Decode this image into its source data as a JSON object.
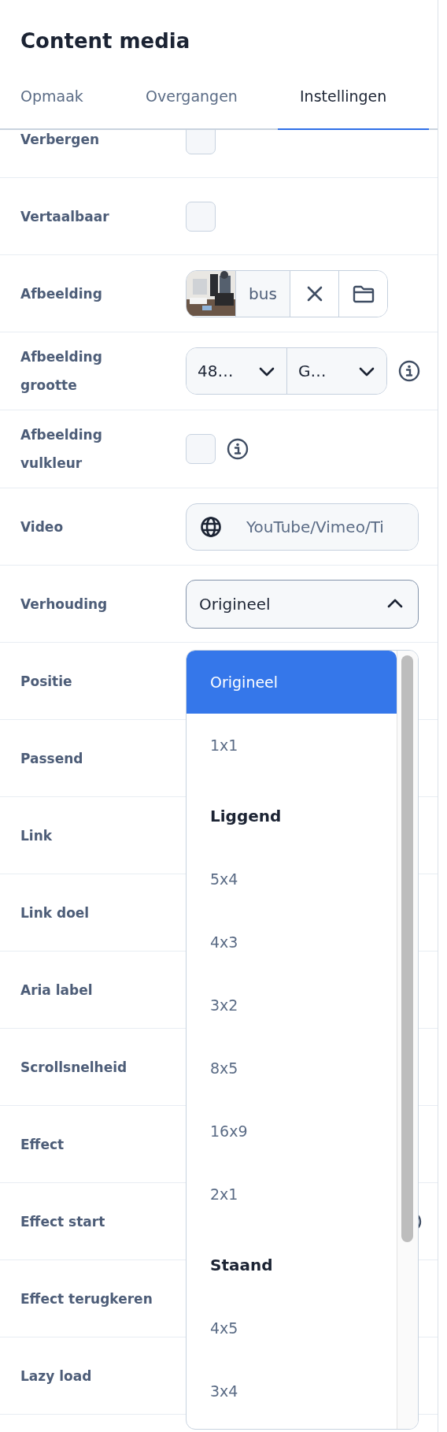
{
  "panel": {
    "title": "Content media"
  },
  "tabs": [
    {
      "label": "Opmaak",
      "selected": false
    },
    {
      "label": "Overgangen",
      "selected": false
    },
    {
      "label": "Instellingen",
      "selected": true
    }
  ],
  "rows": [
    {
      "label": "Verbergen",
      "kind": "checkbox",
      "checked": false
    },
    {
      "label": "Vertaalbaar",
      "kind": "checkbox",
      "checked": false
    },
    {
      "label": "Afbeelding",
      "value": "bus"
    },
    {
      "label": "Afbeelding grootte",
      "kind": "select-pair",
      "values": [
        "48…",
        "G…"
      ],
      "info": true
    },
    {
      "label": "Afbeelding vulkleur",
      "kind": "checkbox",
      "checked": false,
      "info": true
    },
    {
      "label": "Video",
      "kind": "url",
      "placeholder": "YouTube/Vimeo/Ti"
    },
    {
      "label": "Verhouding",
      "kind": "select",
      "value": "Origineel",
      "expanded": true
    },
    {
      "label": "Positie",
      "kind": "none"
    },
    {
      "label": "Passend",
      "kind": "none"
    },
    {
      "label": "Link",
      "kind": "none"
    },
    {
      "label": "Link doel",
      "kind": "none"
    },
    {
      "label": "Aria label",
      "kind": "none"
    },
    {
      "label": "Scrollsnelheid",
      "kind": "none"
    },
    {
      "label": "Effect",
      "kind": "none"
    },
    {
      "label": "Effect start",
      "kind": "none",
      "info": true
    },
    {
      "label": "Effect terugkeren",
      "kind": "none"
    },
    {
      "label": "Lazy load",
      "kind": "none"
    }
  ],
  "dropdown": {
    "items": [
      {
        "kind": "option",
        "label": "Origineel",
        "selected": true
      },
      {
        "kind": "option",
        "label": "1x1",
        "selected": false
      },
      {
        "kind": "header",
        "label": "Liggend"
      },
      {
        "kind": "option",
        "label": "5x4",
        "selected": false
      },
      {
        "kind": "option",
        "label": "4x3",
        "selected": false
      },
      {
        "kind": "option",
        "label": "3x2",
        "selected": false
      },
      {
        "kind": "option",
        "label": "8x5",
        "selected": false
      },
      {
        "kind": "option",
        "label": "16x9",
        "selected": false
      },
      {
        "kind": "option",
        "label": "2x1",
        "selected": false
      },
      {
        "kind": "header",
        "label": "Staand"
      },
      {
        "kind": "option",
        "label": "4x5",
        "selected": false
      },
      {
        "kind": "option",
        "label": "3x4",
        "selected": false
      }
    ]
  }
}
